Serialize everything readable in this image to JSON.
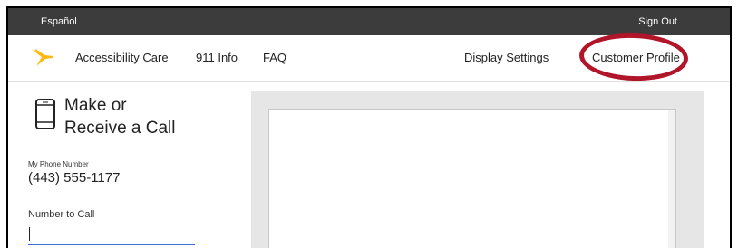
{
  "topbar": {
    "language_label": "Español",
    "signout_label": "Sign Out"
  },
  "nav": {
    "items": [
      {
        "label": "Accessibility Care"
      },
      {
        "label": "911 Info"
      },
      {
        "label": "FAQ"
      },
      {
        "label": "Display Settings"
      },
      {
        "label": "Customer Profile"
      }
    ],
    "logo_icon": "sprint-logo-icon",
    "highlight_color": "#b0152a"
  },
  "sidebar": {
    "title_line1": "Make or",
    "title_line2": "Receive a Call",
    "icon": "mobile-phone-icon",
    "my_phone_label": "My Phone Number",
    "my_phone_value": "(443) 555-1177",
    "number_to_call_label": "Number to Call",
    "number_to_call_value": ""
  },
  "colors": {
    "topbar_bg": "#3c3c3c",
    "accent_blue": "#3a6fd8",
    "logo_yellow": "#fdb913"
  }
}
